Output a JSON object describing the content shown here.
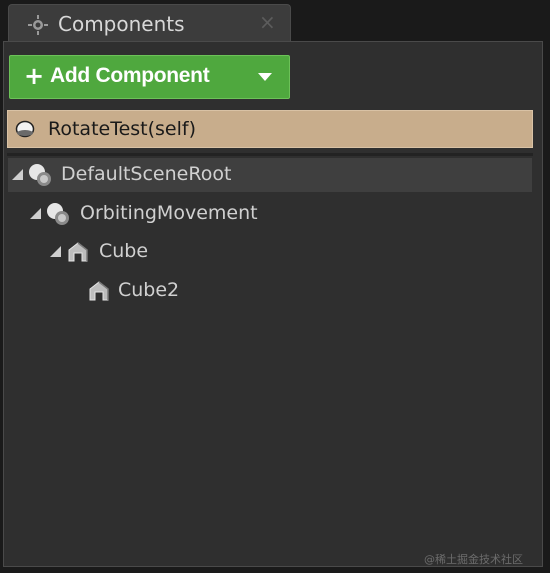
{
  "tab": {
    "title": "Components",
    "close": "×",
    "icon": "components-icon"
  },
  "toolbar": {
    "add_plus": "+",
    "add_label": "Add Component",
    "add_caret_icon": "caret-down-icon",
    "add_color": "#4fa83e"
  },
  "self_row": {
    "label": "RotateTest(self)",
    "icon": "blueprint-sphere-icon",
    "color": "#c8ad8c"
  },
  "tree": {
    "items": [
      {
        "label": "DefaultSceneRoot",
        "icon": "scene-component-icon",
        "expanded": true,
        "depth": 0
      },
      {
        "label": "OrbitingMovement",
        "icon": "scene-component-icon",
        "expanded": true,
        "depth": 1
      },
      {
        "label": "Cube",
        "icon": "static-mesh-icon",
        "expanded": true,
        "depth": 2
      },
      {
        "label": "Cube2",
        "icon": "static-mesh-icon",
        "expanded": false,
        "depth": 3
      }
    ]
  },
  "watermark": "@稀土掘金技术社区"
}
